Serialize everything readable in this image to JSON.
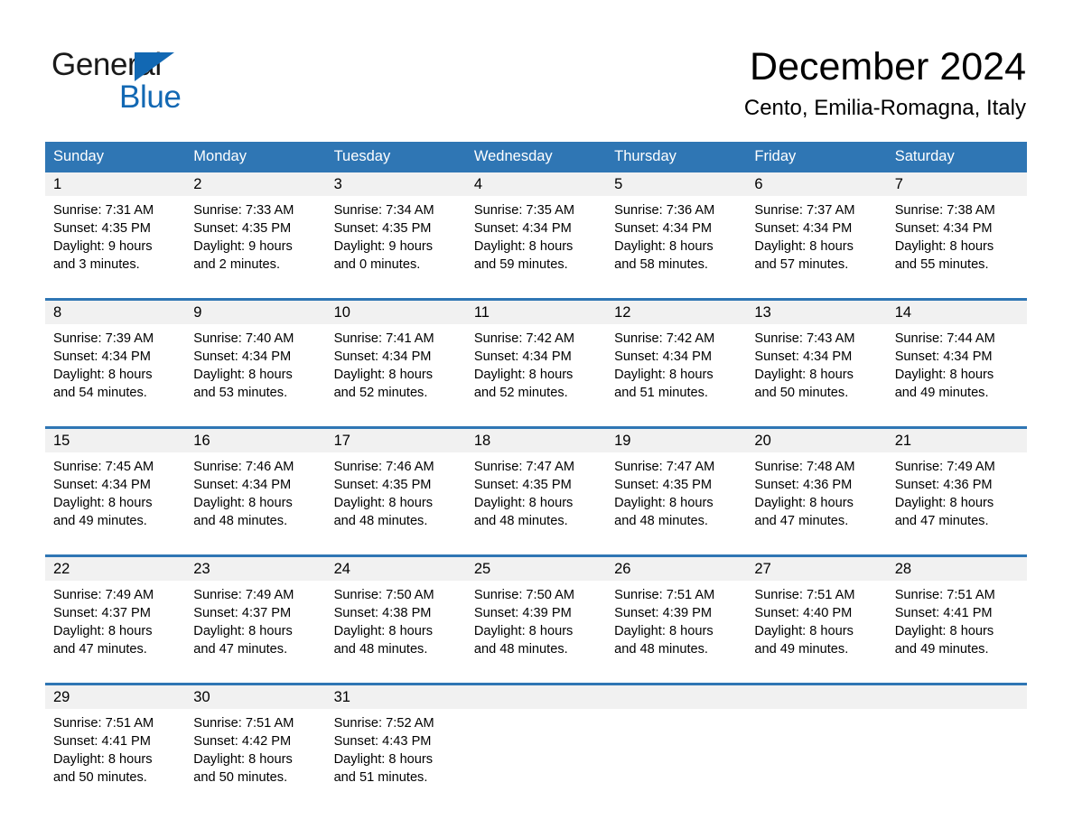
{
  "branding": {
    "name_dark": "General",
    "name_light": "Blue",
    "triangle_color": "#1268b3"
  },
  "header": {
    "title": "December 2024",
    "location": "Cento, Emilia-Romagna, Italy"
  },
  "theme": {
    "header_blue": "#2f76b4",
    "daynum_band": "#f1f1f1",
    "text": "#000000"
  },
  "weekday_headers": [
    "Sunday",
    "Monday",
    "Tuesday",
    "Wednesday",
    "Thursday",
    "Friday",
    "Saturday"
  ],
  "weeks": [
    [
      {
        "day": "1",
        "sunrise": "Sunrise: 7:31 AM",
        "sunset": "Sunset: 4:35 PM",
        "daylight1": "Daylight: 9 hours",
        "daylight2": "and 3 minutes."
      },
      {
        "day": "2",
        "sunrise": "Sunrise: 7:33 AM",
        "sunset": "Sunset: 4:35 PM",
        "daylight1": "Daylight: 9 hours",
        "daylight2": "and 2 minutes."
      },
      {
        "day": "3",
        "sunrise": "Sunrise: 7:34 AM",
        "sunset": "Sunset: 4:35 PM",
        "daylight1": "Daylight: 9 hours",
        "daylight2": "and 0 minutes."
      },
      {
        "day": "4",
        "sunrise": "Sunrise: 7:35 AM",
        "sunset": "Sunset: 4:34 PM",
        "daylight1": "Daylight: 8 hours",
        "daylight2": "and 59 minutes."
      },
      {
        "day": "5",
        "sunrise": "Sunrise: 7:36 AM",
        "sunset": "Sunset: 4:34 PM",
        "daylight1": "Daylight: 8 hours",
        "daylight2": "and 58 minutes."
      },
      {
        "day": "6",
        "sunrise": "Sunrise: 7:37 AM",
        "sunset": "Sunset: 4:34 PM",
        "daylight1": "Daylight: 8 hours",
        "daylight2": "and 57 minutes."
      },
      {
        "day": "7",
        "sunrise": "Sunrise: 7:38 AM",
        "sunset": "Sunset: 4:34 PM",
        "daylight1": "Daylight: 8 hours",
        "daylight2": "and 55 minutes."
      }
    ],
    [
      {
        "day": "8",
        "sunrise": "Sunrise: 7:39 AM",
        "sunset": "Sunset: 4:34 PM",
        "daylight1": "Daylight: 8 hours",
        "daylight2": "and 54 minutes."
      },
      {
        "day": "9",
        "sunrise": "Sunrise: 7:40 AM",
        "sunset": "Sunset: 4:34 PM",
        "daylight1": "Daylight: 8 hours",
        "daylight2": "and 53 minutes."
      },
      {
        "day": "10",
        "sunrise": "Sunrise: 7:41 AM",
        "sunset": "Sunset: 4:34 PM",
        "daylight1": "Daylight: 8 hours",
        "daylight2": "and 52 minutes."
      },
      {
        "day": "11",
        "sunrise": "Sunrise: 7:42 AM",
        "sunset": "Sunset: 4:34 PM",
        "daylight1": "Daylight: 8 hours",
        "daylight2": "and 52 minutes."
      },
      {
        "day": "12",
        "sunrise": "Sunrise: 7:42 AM",
        "sunset": "Sunset: 4:34 PM",
        "daylight1": "Daylight: 8 hours",
        "daylight2": "and 51 minutes."
      },
      {
        "day": "13",
        "sunrise": "Sunrise: 7:43 AM",
        "sunset": "Sunset: 4:34 PM",
        "daylight1": "Daylight: 8 hours",
        "daylight2": "and 50 minutes."
      },
      {
        "day": "14",
        "sunrise": "Sunrise: 7:44 AM",
        "sunset": "Sunset: 4:34 PM",
        "daylight1": "Daylight: 8 hours",
        "daylight2": "and 49 minutes."
      }
    ],
    [
      {
        "day": "15",
        "sunrise": "Sunrise: 7:45 AM",
        "sunset": "Sunset: 4:34 PM",
        "daylight1": "Daylight: 8 hours",
        "daylight2": "and 49 minutes."
      },
      {
        "day": "16",
        "sunrise": "Sunrise: 7:46 AM",
        "sunset": "Sunset: 4:34 PM",
        "daylight1": "Daylight: 8 hours",
        "daylight2": "and 48 minutes."
      },
      {
        "day": "17",
        "sunrise": "Sunrise: 7:46 AM",
        "sunset": "Sunset: 4:35 PM",
        "daylight1": "Daylight: 8 hours",
        "daylight2": "and 48 minutes."
      },
      {
        "day": "18",
        "sunrise": "Sunrise: 7:47 AM",
        "sunset": "Sunset: 4:35 PM",
        "daylight1": "Daylight: 8 hours",
        "daylight2": "and 48 minutes."
      },
      {
        "day": "19",
        "sunrise": "Sunrise: 7:47 AM",
        "sunset": "Sunset: 4:35 PM",
        "daylight1": "Daylight: 8 hours",
        "daylight2": "and 48 minutes."
      },
      {
        "day": "20",
        "sunrise": "Sunrise: 7:48 AM",
        "sunset": "Sunset: 4:36 PM",
        "daylight1": "Daylight: 8 hours",
        "daylight2": "and 47 minutes."
      },
      {
        "day": "21",
        "sunrise": "Sunrise: 7:49 AM",
        "sunset": "Sunset: 4:36 PM",
        "daylight1": "Daylight: 8 hours",
        "daylight2": "and 47 minutes."
      }
    ],
    [
      {
        "day": "22",
        "sunrise": "Sunrise: 7:49 AM",
        "sunset": "Sunset: 4:37 PM",
        "daylight1": "Daylight: 8 hours",
        "daylight2": "and 47 minutes."
      },
      {
        "day": "23",
        "sunrise": "Sunrise: 7:49 AM",
        "sunset": "Sunset: 4:37 PM",
        "daylight1": "Daylight: 8 hours",
        "daylight2": "and 47 minutes."
      },
      {
        "day": "24",
        "sunrise": "Sunrise: 7:50 AM",
        "sunset": "Sunset: 4:38 PM",
        "daylight1": "Daylight: 8 hours",
        "daylight2": "and 48 minutes."
      },
      {
        "day": "25",
        "sunrise": "Sunrise: 7:50 AM",
        "sunset": "Sunset: 4:39 PM",
        "daylight1": "Daylight: 8 hours",
        "daylight2": "and 48 minutes."
      },
      {
        "day": "26",
        "sunrise": "Sunrise: 7:51 AM",
        "sunset": "Sunset: 4:39 PM",
        "daylight1": "Daylight: 8 hours",
        "daylight2": "and 48 minutes."
      },
      {
        "day": "27",
        "sunrise": "Sunrise: 7:51 AM",
        "sunset": "Sunset: 4:40 PM",
        "daylight1": "Daylight: 8 hours",
        "daylight2": "and 49 minutes."
      },
      {
        "day": "28",
        "sunrise": "Sunrise: 7:51 AM",
        "sunset": "Sunset: 4:41 PM",
        "daylight1": "Daylight: 8 hours",
        "daylight2": "and 49 minutes."
      }
    ],
    [
      {
        "day": "29",
        "sunrise": "Sunrise: 7:51 AM",
        "sunset": "Sunset: 4:41 PM",
        "daylight1": "Daylight: 8 hours",
        "daylight2": "and 50 minutes."
      },
      {
        "day": "30",
        "sunrise": "Sunrise: 7:51 AM",
        "sunset": "Sunset: 4:42 PM",
        "daylight1": "Daylight: 8 hours",
        "daylight2": "and 50 minutes."
      },
      {
        "day": "31",
        "sunrise": "Sunrise: 7:52 AM",
        "sunset": "Sunset: 4:43 PM",
        "daylight1": "Daylight: 8 hours",
        "daylight2": "and 51 minutes."
      },
      {
        "day": "",
        "sunrise": "",
        "sunset": "",
        "daylight1": "",
        "daylight2": ""
      },
      {
        "day": "",
        "sunrise": "",
        "sunset": "",
        "daylight1": "",
        "daylight2": ""
      },
      {
        "day": "",
        "sunrise": "",
        "sunset": "",
        "daylight1": "",
        "daylight2": ""
      },
      {
        "day": "",
        "sunrise": "",
        "sunset": "",
        "daylight1": "",
        "daylight2": ""
      }
    ]
  ]
}
